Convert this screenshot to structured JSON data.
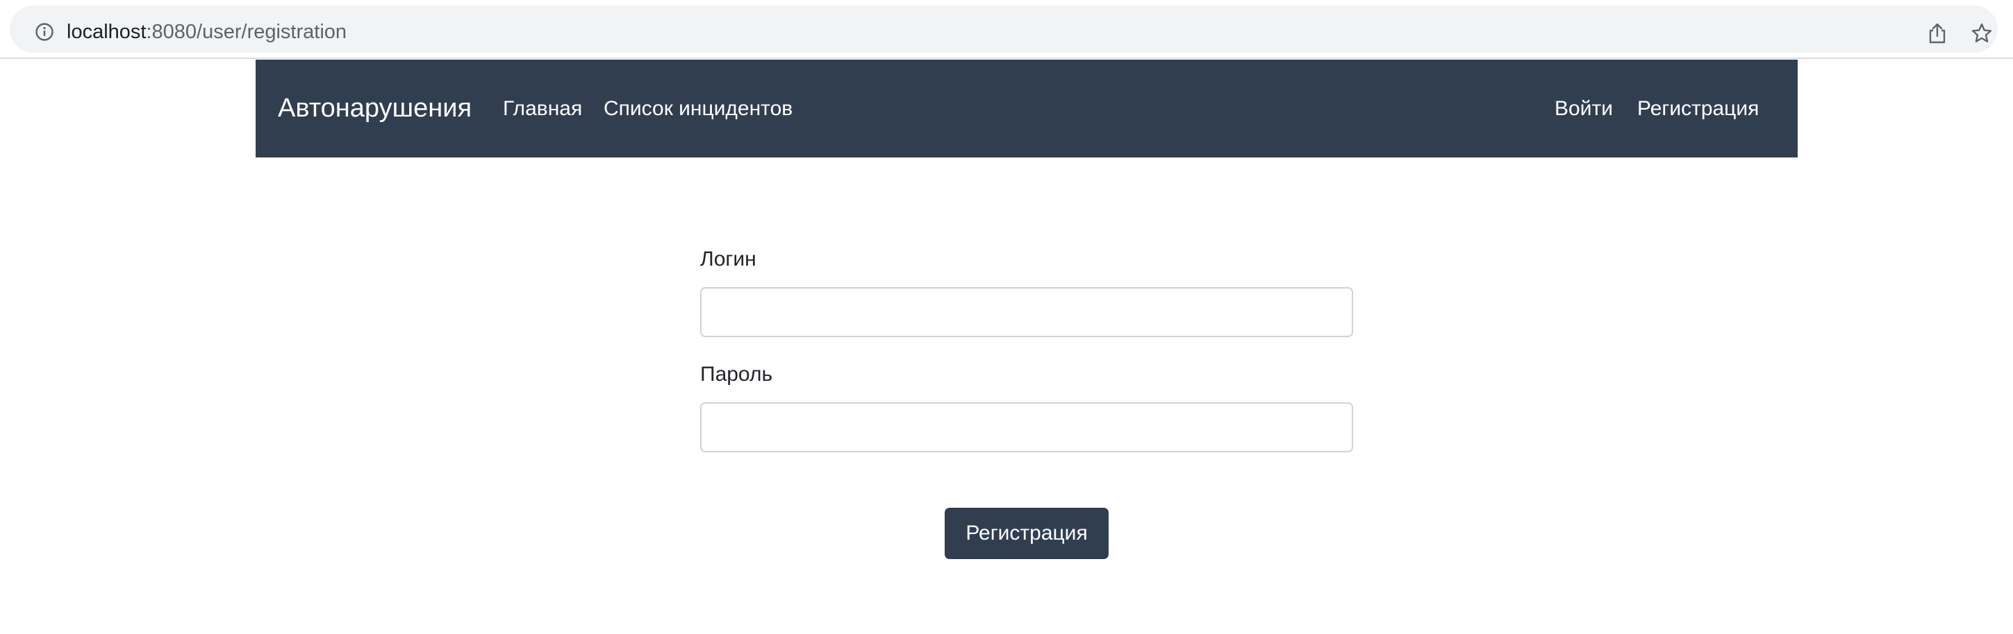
{
  "browser": {
    "url_host": "localhost",
    "url_path": ":8080/user/registration",
    "icons": {
      "info": "info-icon",
      "share": "share-icon",
      "bookmark": "star-icon"
    }
  },
  "navbar": {
    "brand": "Автонарушения",
    "links": {
      "home": "Главная",
      "incidents": "Список инцидентов",
      "login": "Войти",
      "register": "Регистрация"
    },
    "background_color": "#313e50"
  },
  "form": {
    "login_label": "Логин",
    "login_value": "",
    "password_label": "Пароль",
    "password_value": "",
    "submit_label": "Регистрация"
  },
  "colors": {
    "accent": "#313e50",
    "text": "#212529",
    "input_border": "#ced4da"
  }
}
